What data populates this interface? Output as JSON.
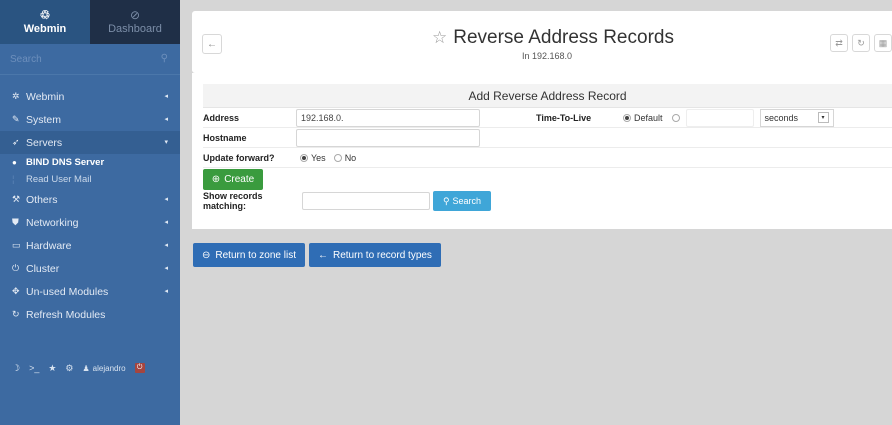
{
  "sidebar": {
    "tabs": [
      {
        "label": "Webmin",
        "icon": "webmin-logo-icon"
      },
      {
        "label": "Dashboard",
        "icon": "dashboard-icon"
      }
    ],
    "search_placeholder": "Search",
    "items": [
      {
        "label": "Webmin",
        "icon": "gear-icon"
      },
      {
        "label": "System",
        "icon": "wrench-icon"
      },
      {
        "label": "Servers",
        "icon": "rocket-icon"
      },
      {
        "label": "Others",
        "icon": "wrench-icon"
      },
      {
        "label": "Networking",
        "icon": "shield-icon"
      },
      {
        "label": "Hardware",
        "icon": "hardware-icon"
      },
      {
        "label": "Cluster",
        "icon": "power-icon"
      },
      {
        "label": "Un-used Modules",
        "icon": "puzzle-icon"
      },
      {
        "label": "Refresh Modules",
        "icon": "refresh-icon"
      }
    ],
    "subitems": [
      {
        "label": "BIND DNS Server"
      },
      {
        "label": "Read User Mail"
      }
    ],
    "username": "alejandro"
  },
  "header": {
    "title": "Reverse Address Records",
    "subtitle": "In 192.168.0"
  },
  "form": {
    "title": "Add Reverse Address Record",
    "address_label": "Address",
    "address_value": "192.168.0.",
    "ttl_label": "Time-To-Live",
    "ttl_default_label": "Default",
    "ttl_unit": "seconds",
    "hostname_label": "Hostname",
    "hostname_value": "",
    "update_label": "Update forward?",
    "update_yes": "Yes",
    "update_no": "No",
    "create_label": "Create",
    "search_label": "Show records matching:",
    "search_button": "Search"
  },
  "footer": {
    "return_zone": "Return to zone list",
    "return_types": "Return to record types"
  },
  "colors": {
    "sidebar": "#3d6aa1",
    "create": "#3a9b3e",
    "search": "#3fa6d8",
    "return": "#2f6db5"
  }
}
